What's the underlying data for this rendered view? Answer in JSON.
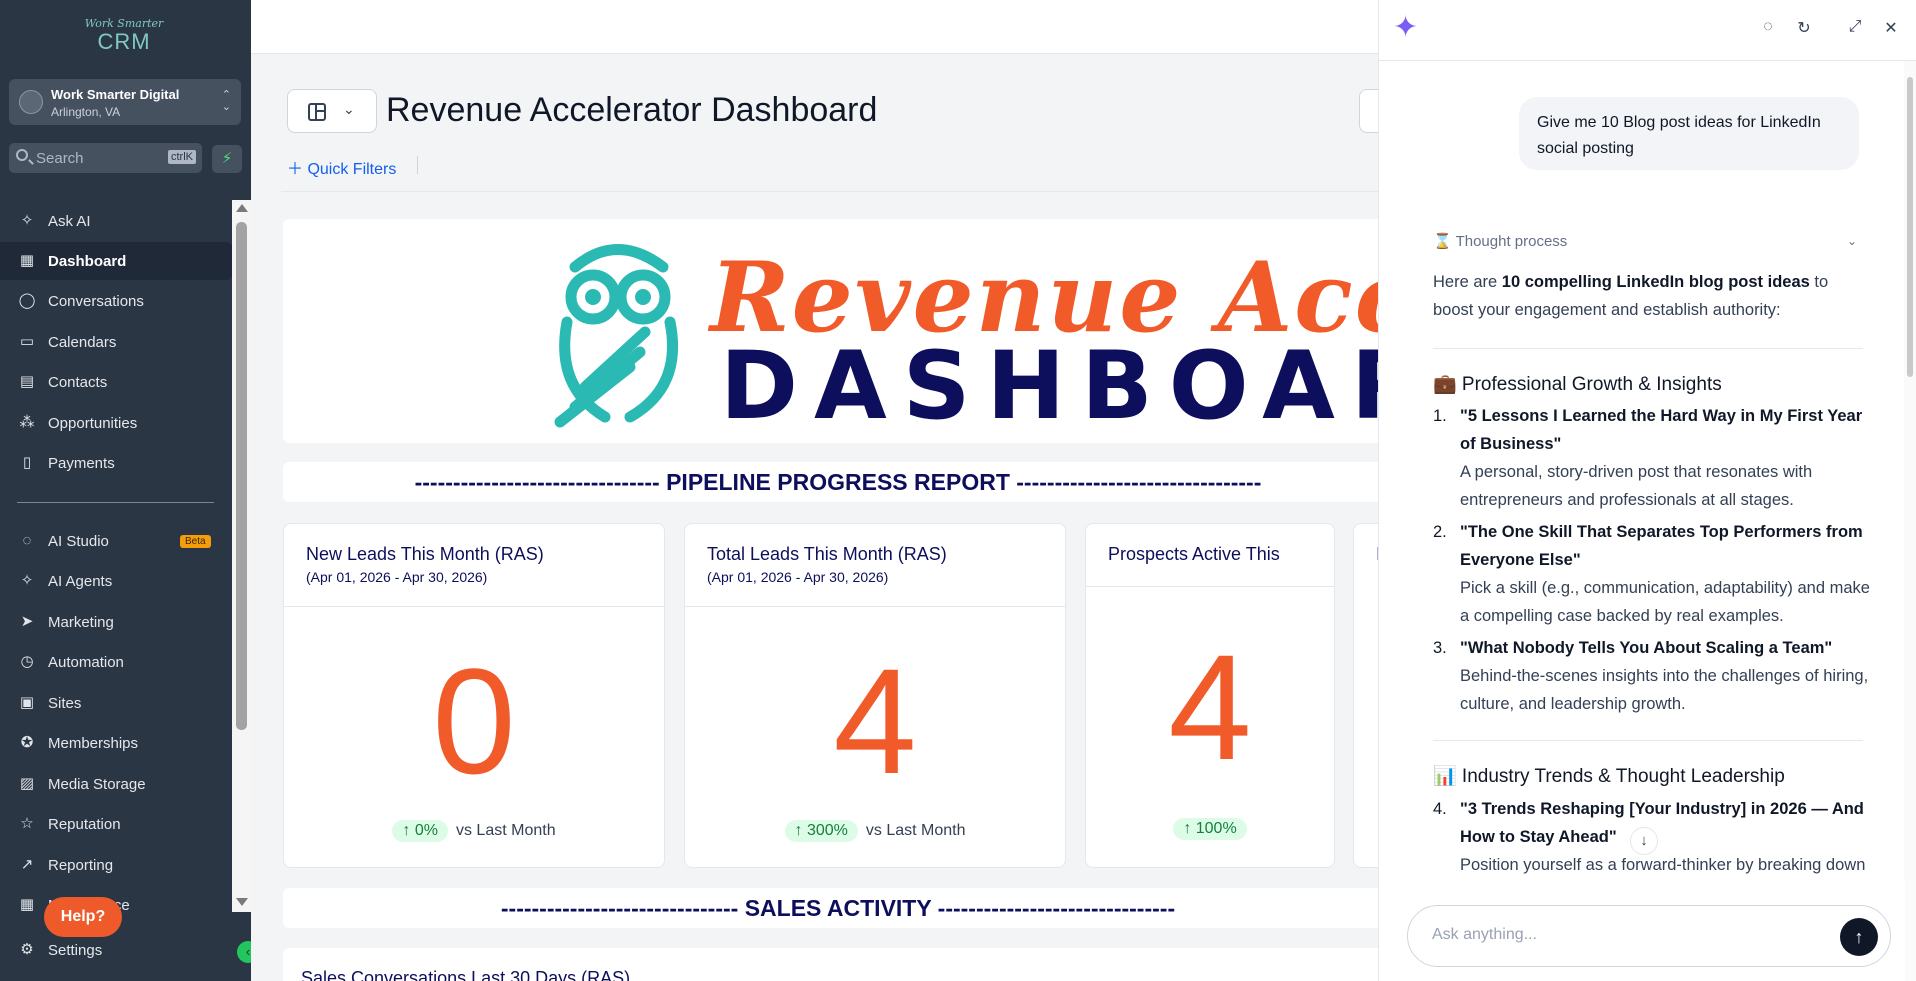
{
  "sidebar": {
    "logo_line1": "Work Smarter",
    "logo_line2": "CRM",
    "account_name": "Work Smarter Digital",
    "account_location": "Arlington, VA",
    "search_placeholder": "Search",
    "search_shortcut": "ctrlK",
    "items": [
      {
        "label": "Ask AI",
        "icon": "sparkle-icon"
      },
      {
        "label": "Dashboard",
        "icon": "grid-icon",
        "active": true
      },
      {
        "label": "Conversations",
        "icon": "chat-bubble-icon"
      },
      {
        "label": "Calendars",
        "icon": "calendar-icon"
      },
      {
        "label": "Contacts",
        "icon": "contacts-icon"
      },
      {
        "label": "Opportunities",
        "icon": "opportunities-icon"
      },
      {
        "label": "Payments",
        "icon": "payments-icon"
      },
      {
        "label": "AI Studio",
        "icon": "ai-studio-icon",
        "badge": "Beta"
      },
      {
        "label": "AI Agents",
        "icon": "sparkle-icon"
      },
      {
        "label": "Marketing",
        "icon": "send-icon"
      },
      {
        "label": "Automation",
        "icon": "automation-icon"
      },
      {
        "label": "Sites",
        "icon": "sites-icon"
      },
      {
        "label": "Memberships",
        "icon": "award-icon"
      },
      {
        "label": "Media Storage",
        "icon": "image-icon"
      },
      {
        "label": "Reputation",
        "icon": "star-icon"
      },
      {
        "label": "Reporting",
        "icon": "trend-icon"
      },
      {
        "label": "Marketplace",
        "icon": "apps-icon"
      },
      {
        "label": "Settings",
        "icon": "gear-icon"
      }
    ],
    "help_label": "Help?"
  },
  "main": {
    "title": "Revenue Accelerator Dashboard",
    "quick_filters": "Quick Filters",
    "banner_line1": "Revenue Accelerator",
    "banner_line2": "DASHBOARD",
    "section_pipeline": "-------------------------------- PIPELINE PROGRESS REPORT --------------------------------",
    "section_sales": "------------------------------- SALES ACTIVITY -------------------------------",
    "cards": [
      {
        "title": "New Leads This Month (RAS)",
        "subtitle": "(Apr 01, 2026 - Apr 30, 2026)",
        "value": "0",
        "change": "↑ 0%",
        "compare": "vs Last Month"
      },
      {
        "title": "Total Leads This Month (RAS)",
        "subtitle": "(Apr 01, 2026 - Apr 30, 2026)",
        "value": "4",
        "change": "↑ 300%",
        "compare": "vs Last Month"
      },
      {
        "title": "Prospects Active This",
        "subtitle": "",
        "value": "4",
        "change": "↑ 100%",
        "compare": ""
      },
      {
        "title": "I",
        "subtitle": "",
        "value": "",
        "change": "",
        "compare": ""
      }
    ],
    "sales_card_title": "Sales Conversations Last 30 Days (RAS)"
  },
  "chat": {
    "user_message": "Give me 10 Blog post ideas for LinkedIn social posting",
    "thought_label": "Thought process",
    "intro_pre": "Here are ",
    "intro_bold": "10 compelling LinkedIn blog post ideas",
    "intro_post": " to boost your engagement and establish authority:",
    "section1": "💼 Professional Growth & Insights",
    "ideas": [
      {
        "num": "1.",
        "title": "\"5 Lessons I Learned the Hard Way in My First Year of Business\"",
        "desc": "A personal, story-driven post that resonates with entrepreneurs and professionals at all stages."
      },
      {
        "num": "2.",
        "title": "\"The One Skill That Separates Top Performers from Everyone Else\"",
        "desc": "Pick a skill (e.g., communication, adaptability) and make a compelling case backed by real examples."
      },
      {
        "num": "3.",
        "title": "\"What Nobody Tells You About Scaling a Team\"",
        "desc": "Behind-the-scenes insights into the challenges of hiring, culture, and leadership growth."
      },
      {
        "num": "4.",
        "title": "\"3 Trends Reshaping [Your Industry] in 2026 — And How to Stay Ahead\"",
        "desc": "Position yourself as a forward-thinker by breaking down emerging trends with"
      }
    ],
    "section2": "📊 Industry Trends & Thought Leadership",
    "input_placeholder": "Ask anything..."
  }
}
